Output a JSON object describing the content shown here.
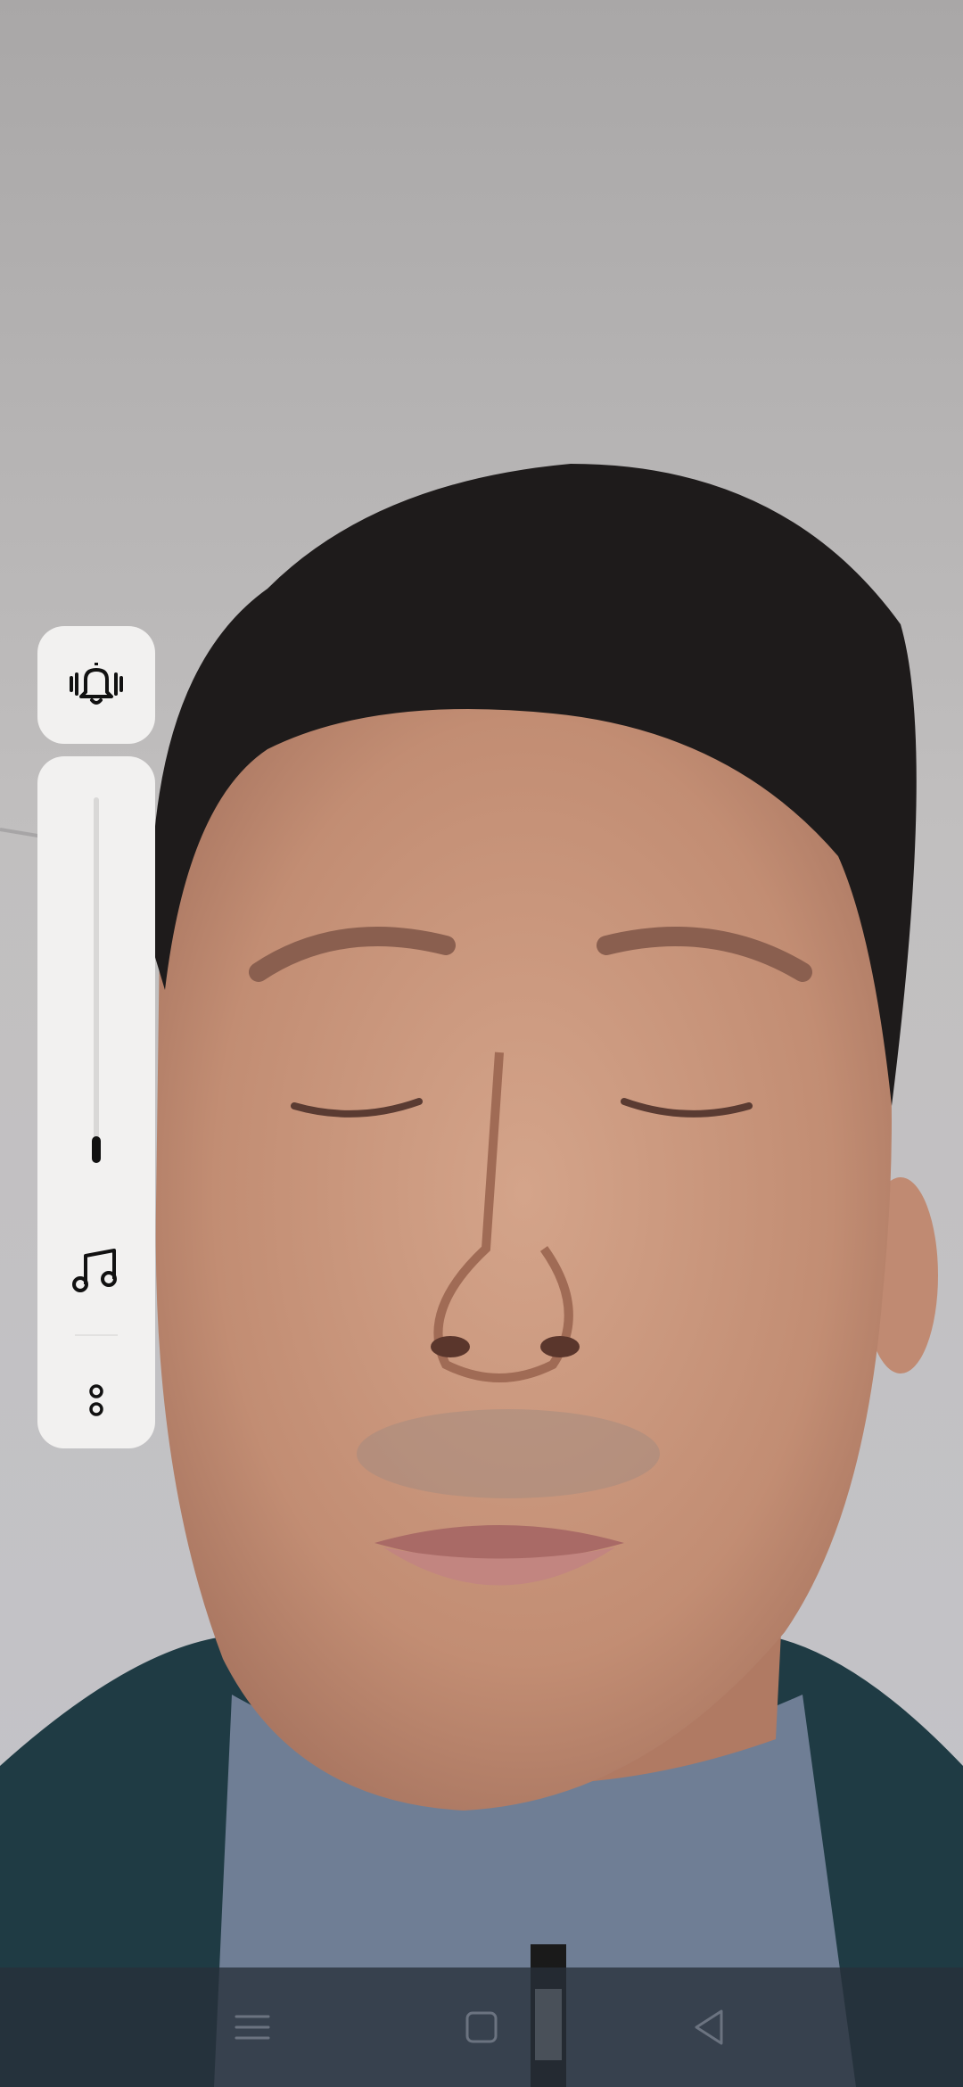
{
  "volume_panel": {
    "ring_mode_icon": "bell-vibrate-icon",
    "media_icon": "music-note-icon",
    "more_icon": "more-dots-icon",
    "volume_level": 0.0
  },
  "navigation_bar": {
    "buttons": [
      {
        "name": "menu",
        "icon": "menu-lines-icon"
      },
      {
        "name": "home",
        "icon": "square-home-icon"
      },
      {
        "name": "back",
        "icon": "triangle-back-icon"
      }
    ]
  },
  "colors": {
    "panel_background": "#f2f1f0",
    "icon": "#111111",
    "nav_bar": "#28303a"
  }
}
